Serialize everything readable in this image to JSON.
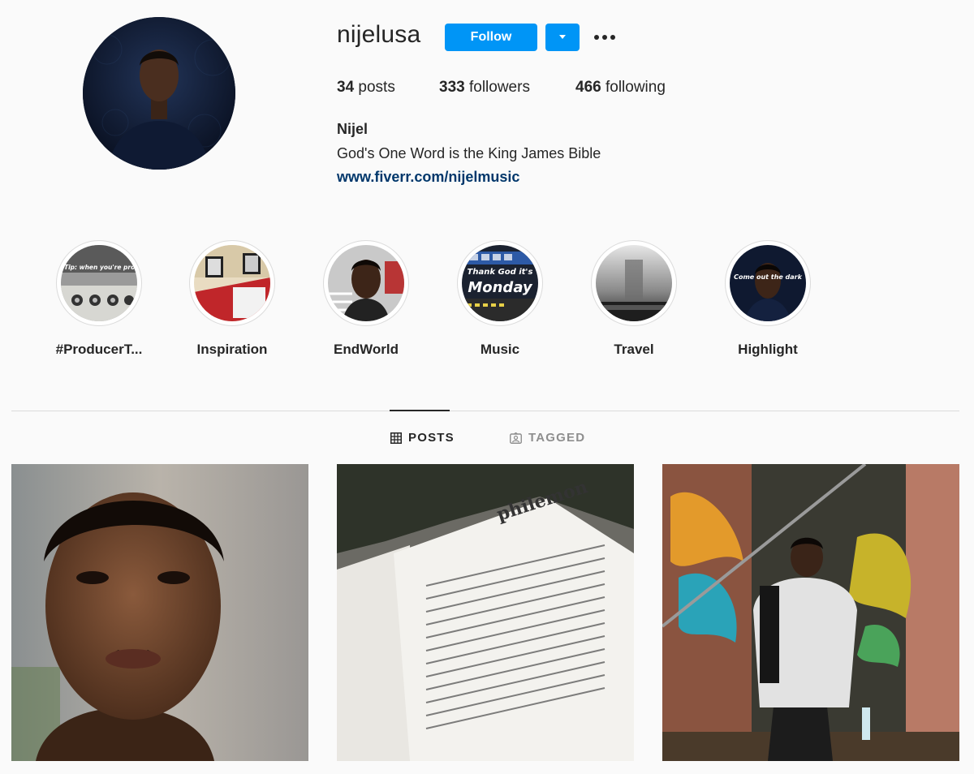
{
  "profile": {
    "username": "nijelusa",
    "follow_label": "Follow",
    "posts_count": "34",
    "posts_label": " posts",
    "followers_count": "333",
    "followers_label": " followers",
    "following_count": "466",
    "following_label": " following",
    "full_name": "Nijel",
    "bio": "God's One Word is the King James Bible",
    "website": "www.fiverr.com/nijelmusic"
  },
  "highlights": [
    {
      "label": "#ProducerT...",
      "overlay_text": "Tip: when you're producing use these"
    },
    {
      "label": "Inspiration"
    },
    {
      "label": "EndWorld"
    },
    {
      "label": "Music",
      "overlay_line1": "Thank God it's",
      "overlay_line2": "Monday"
    },
    {
      "label": "Travel"
    },
    {
      "label": "Highlight",
      "overlay_text": "Come out the dark"
    }
  ],
  "tabs": [
    {
      "label": "POSTS",
      "active": true,
      "icon": "grid-icon"
    },
    {
      "label": "TAGGED",
      "active": false,
      "icon": "tagged-icon"
    }
  ],
  "posts": [
    {
      "subject": "portrait"
    },
    {
      "subject": "bible-philemon",
      "page_header": "philemon"
    },
    {
      "subject": "graffiti-alley"
    }
  ],
  "colors": {
    "accent": "#0095f6",
    "link": "#00376b",
    "text": "#262626",
    "muted": "#8e8e8e",
    "background": "#fafafa"
  }
}
